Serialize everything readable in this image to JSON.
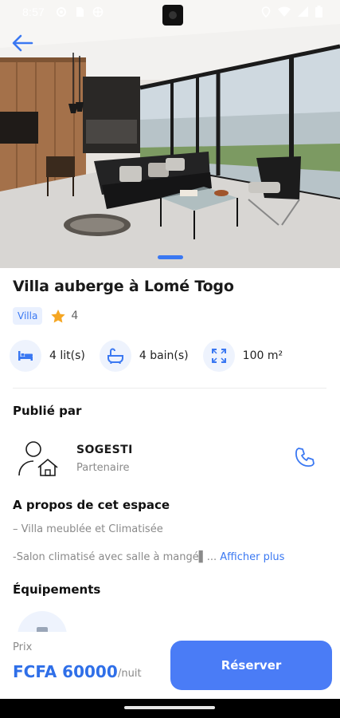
{
  "status_bar": {
    "time": "8:57"
  },
  "hero": {
    "image_alt": "living room photo",
    "slide_indicator_active": 1
  },
  "listing": {
    "title": "Villa auberge à Lomé Togo",
    "badge": "Villa",
    "rating": "4"
  },
  "features": [
    {
      "icon": "bed-icon",
      "label": "4 lit(s)"
    },
    {
      "icon": "bath-icon",
      "label": "4 bain(s)"
    },
    {
      "icon": "area-icon",
      "label": "100 m²"
    }
  ],
  "publisher": {
    "heading": "Publié par",
    "name": "SOGESTI",
    "role": "Partenaire"
  },
  "about": {
    "heading": "A propos de cet espace",
    "line1": "– Villa meublée et Climatisée",
    "line2": "-Salon climatisé avec salle à mangé▌...",
    "show_more": "Afficher plus"
  },
  "equipment": {
    "heading": "Équipements"
  },
  "booking": {
    "price_label": "Prix",
    "price": "FCFA 60000",
    "per": "/nuit",
    "reserve_label": "Réserver"
  },
  "colors": {
    "accent": "#3a78f2",
    "button": "#4a7cf6",
    "icon_bg": "#eef3fd"
  }
}
